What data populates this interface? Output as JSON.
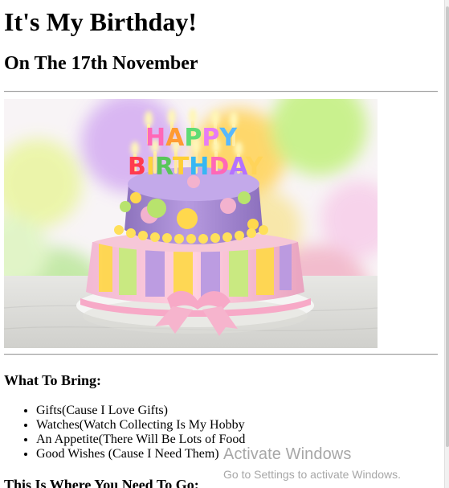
{
  "page": {
    "title": "It's My Birthday!",
    "subtitle": "On The 17th November",
    "image": {
      "icon": "birthday-cake-image",
      "cake_text_top": "HAPPY",
      "cake_text_bottom": "BIRTHDAY"
    }
  },
  "sections": {
    "what_to_bring": {
      "heading": "What To Bring:",
      "items": [
        "Gifts(Cause I Love Gifts)",
        "Watches(Watch Collecting Is My Hobby",
        "An Appetite(There Will Be Lots of Food",
        "Good Wishes (Cause I Need Them)"
      ]
    },
    "where_to_go": {
      "heading": "This Is Where You Need To Go:"
    }
  },
  "system_overlay": {
    "title": "Activate Windows",
    "subtitle": "Go to Settings to activate Windows."
  },
  "colors": {
    "rule": "#9a9a9a",
    "overlay_text": "#a7a7a7",
    "cake_purple": "#aa8ed8",
    "cake_pink": "#f5a9c9"
  }
}
